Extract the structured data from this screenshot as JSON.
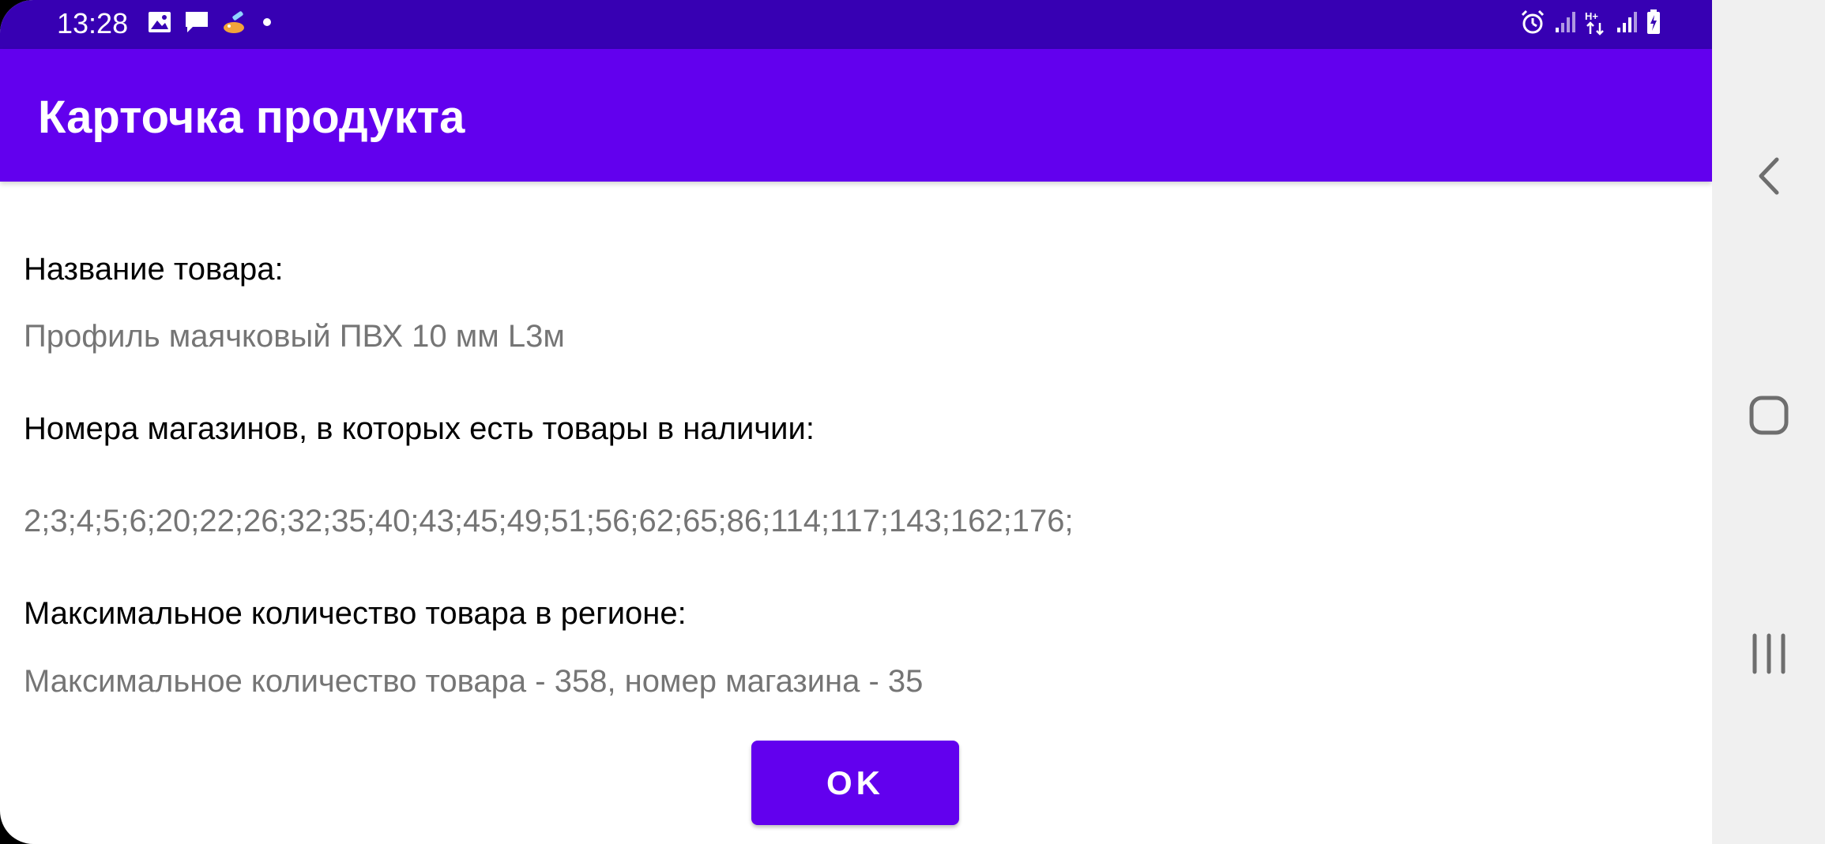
{
  "status_bar": {
    "time": "13:28",
    "left_icons": [
      "image-icon",
      "message-icon",
      "cleaner-icon",
      "dot-icon"
    ],
    "right_icons": [
      "alarm-icon",
      "signal-icon",
      "data-hplus-icon",
      "signal-icon-2",
      "battery-icon"
    ]
  },
  "app_bar": {
    "title": "Карточка продукта"
  },
  "product": {
    "name_label": "Название товара:",
    "name_value": "Профиль маячковый ПВХ 10 мм L3м",
    "stores_label": "Номера магазинов, в которых есть товары в наличии:",
    "stores_value": "2;3;4;5;6;20;22;26;32;35;40;43;45;49;51;56;62;65;86;114;117;143;162;176;",
    "max_label": "Максимальное количество товара в регионе:",
    "max_value": "Максимальное количество товара - 358, номер магазина - 35"
  },
  "buttons": {
    "ok_label": "OK"
  },
  "nav_bar": {
    "buttons": [
      "back-icon",
      "home-icon",
      "recents-icon"
    ]
  },
  "colors": {
    "status_bar": "#3700b3",
    "primary": "#6200ee",
    "label_text": "#000000",
    "value_text": "#757575",
    "nav_bar_bg": "#f0f0f0"
  }
}
